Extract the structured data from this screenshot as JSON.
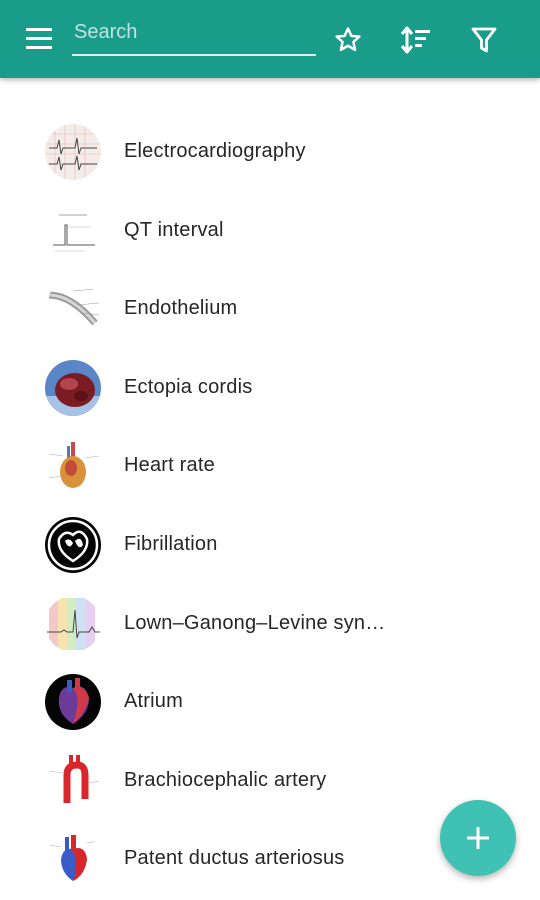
{
  "theme": {
    "appbar_color": "#1a9c8a",
    "fab_color": "#3fc1b3",
    "icon_color": "#ffffff",
    "text_color": "#262626"
  },
  "appbar": {
    "menu_icon": "hamburger-menu-icon",
    "search": {
      "placeholder": "Search",
      "value": ""
    },
    "actions": [
      {
        "name": "favorites",
        "icon": "star-outline-icon"
      },
      {
        "name": "sort",
        "icon": "sort-icon"
      },
      {
        "name": "filter",
        "icon": "filter-icon"
      }
    ]
  },
  "articles": [
    {
      "title": "Electrocardiography",
      "thumbnail": "ecg-grid-thumbnail"
    },
    {
      "title": "QT interval",
      "thumbnail": "qt-waveform-thumbnail"
    },
    {
      "title": "Endothelium",
      "thumbnail": "vessel-diagram-thumbnail"
    },
    {
      "title": "Ectopia cordis",
      "thumbnail": "heart-photo-thumbnail"
    },
    {
      "title": "Heart rate",
      "thumbnail": "heart-anatomy-thumbnail"
    },
    {
      "title": "Fibrillation",
      "thumbnail": "heart-cross-section-thumbnail"
    },
    {
      "title": "Lown–Ganong–Levine syn…",
      "thumbnail": "ecg-colored-bands-thumbnail"
    },
    {
      "title": "Atrium",
      "thumbnail": "heart-diagram-thumbnail"
    },
    {
      "title": "Brachiocephalic artery",
      "thumbnail": "aorta-diagram-thumbnail"
    },
    {
      "title": "Patent ductus arteriosus",
      "thumbnail": "pda-diagram-thumbnail"
    }
  ],
  "fab": {
    "icon": "plus-icon"
  }
}
